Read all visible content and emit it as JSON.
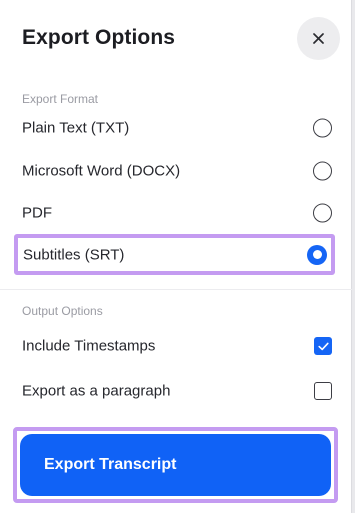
{
  "dialog": {
    "title": "Export Options",
    "close_icon": "close-icon"
  },
  "export_format": {
    "label": "Export Format",
    "options": [
      {
        "label": "Plain Text (TXT)",
        "selected": false
      },
      {
        "label": "Microsoft Word (DOCX)",
        "selected": false
      },
      {
        "label": "PDF",
        "selected": false
      },
      {
        "label": "Subtitles (SRT)",
        "selected": true
      }
    ]
  },
  "output_options": {
    "label": "Output Options",
    "items": [
      {
        "label": "Include Timestamps",
        "checked": true
      },
      {
        "label": "Export as a paragraph",
        "checked": false
      }
    ]
  },
  "actions": {
    "export_label": "Export Transcript"
  },
  "colors": {
    "accent": "#1062f6",
    "highlight": "#c49bf1"
  }
}
